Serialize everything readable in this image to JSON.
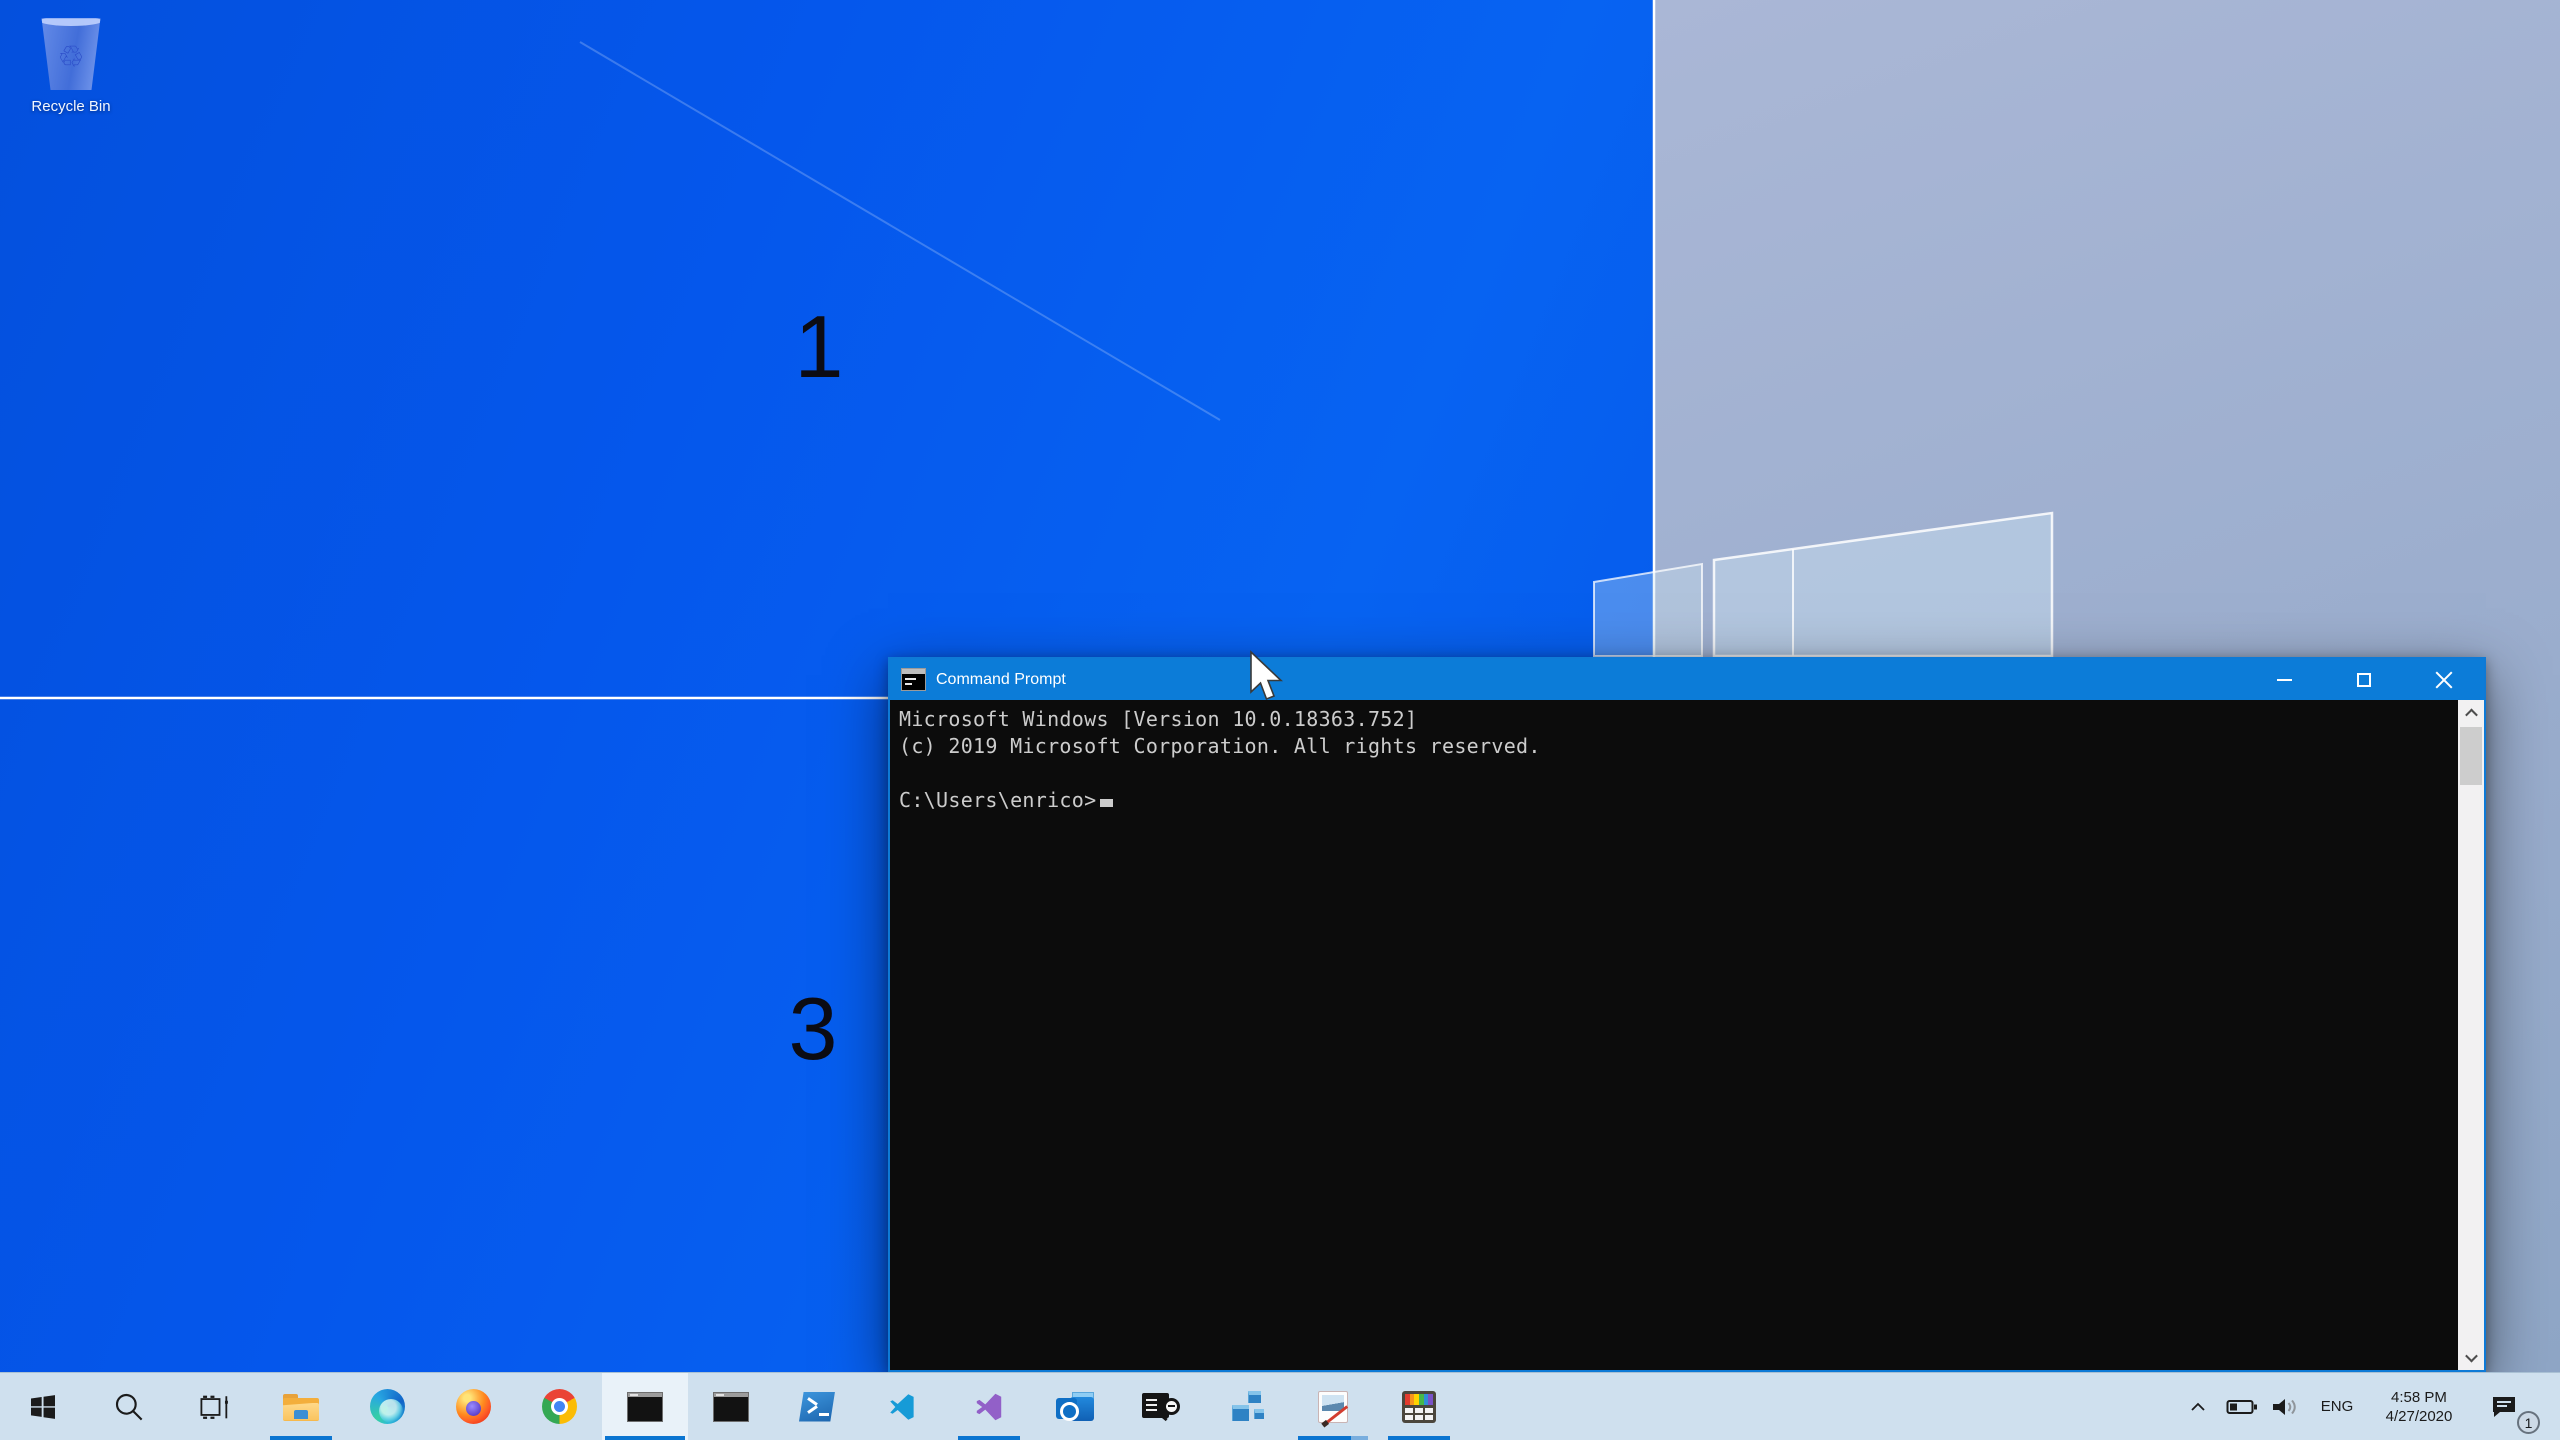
{
  "colors": {
    "accent": "#0078d7",
    "desktop_blue": "#0557ec",
    "desktop_light": "#9fb0d0",
    "taskbar_bg": "#cfe0ee",
    "cmd_bg": "#0c0c0c",
    "cmd_text": "#cccccc",
    "titlebar_blue": "#0c7cd8"
  },
  "desktop": {
    "wallpaper_labels": {
      "quadrant1": "1",
      "quadrant3": "3"
    },
    "recycle_bin": {
      "label": "Recycle Bin",
      "glyph": "♲"
    }
  },
  "cmd": {
    "title": "Command Prompt",
    "lines": [
      "Microsoft Windows [Version 10.0.18363.752]",
      "(c) 2019 Microsoft Corporation. All rights reserved.",
      "",
      "C:\\Users\\enrico>"
    ]
  },
  "taskbar": {
    "items": [
      {
        "name": "start"
      },
      {
        "name": "search"
      },
      {
        "name": "task-view"
      },
      {
        "name": "file-explorer",
        "open": true
      },
      {
        "name": "edge"
      },
      {
        "name": "firefox"
      },
      {
        "name": "chrome"
      },
      {
        "name": "command-prompt",
        "open": true,
        "active": true
      },
      {
        "name": "command-prompt-2"
      },
      {
        "name": "powershell"
      },
      {
        "name": "vscode"
      },
      {
        "name": "visual-studio",
        "open": true
      },
      {
        "name": "outlook"
      },
      {
        "name": "log-viewer"
      },
      {
        "name": "registry-editor"
      },
      {
        "name": "paint",
        "open": true,
        "windows": 2
      },
      {
        "name": "powertoys",
        "open": true
      }
    ]
  },
  "tray": {
    "language": "ENG",
    "time": "4:58 PM",
    "date": "4/27/2020",
    "notification_badge": "1"
  }
}
